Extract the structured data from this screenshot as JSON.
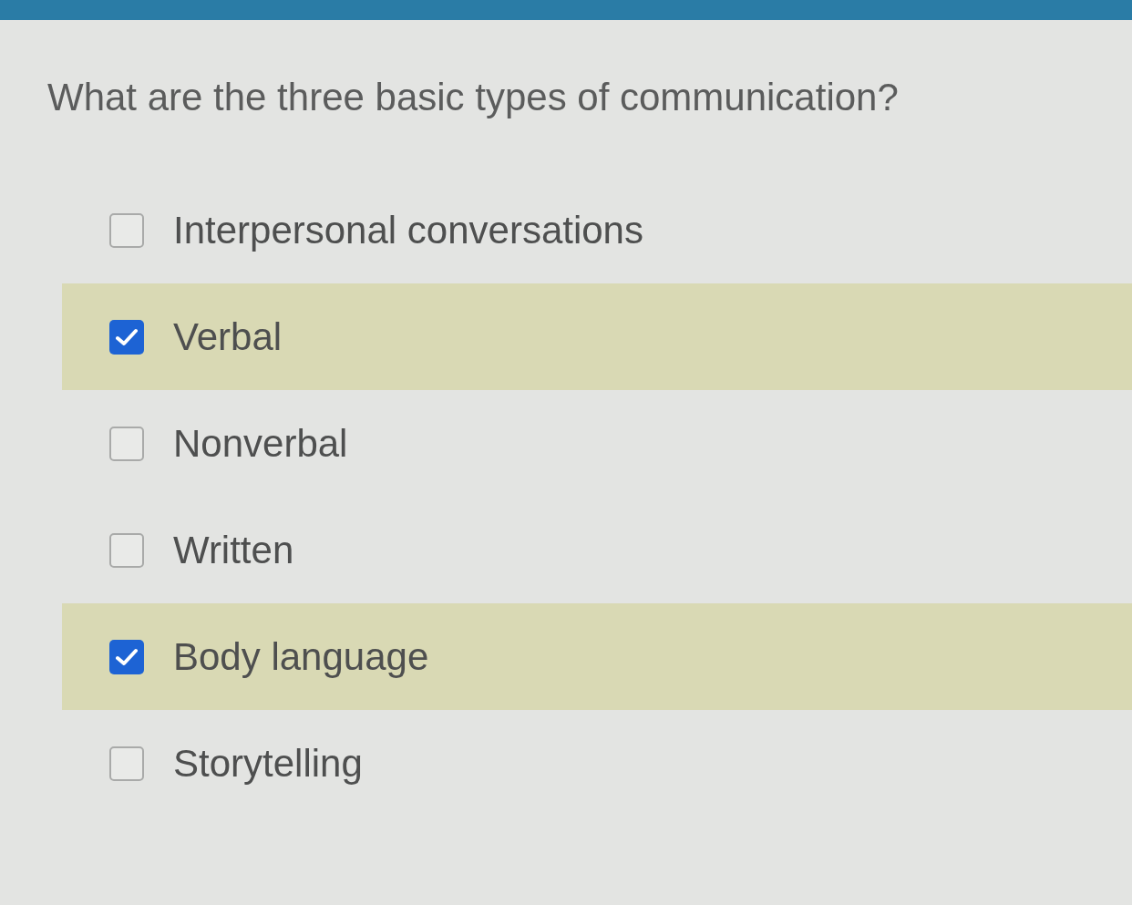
{
  "question": "What are the three basic types of communication?",
  "options": [
    {
      "label": "Interpersonal conversations",
      "checked": false
    },
    {
      "label": "Verbal",
      "checked": true
    },
    {
      "label": "Nonverbal",
      "checked": false
    },
    {
      "label": "Written",
      "checked": false
    },
    {
      "label": "Body language",
      "checked": true
    },
    {
      "label": "Storytelling",
      "checked": false
    }
  ]
}
